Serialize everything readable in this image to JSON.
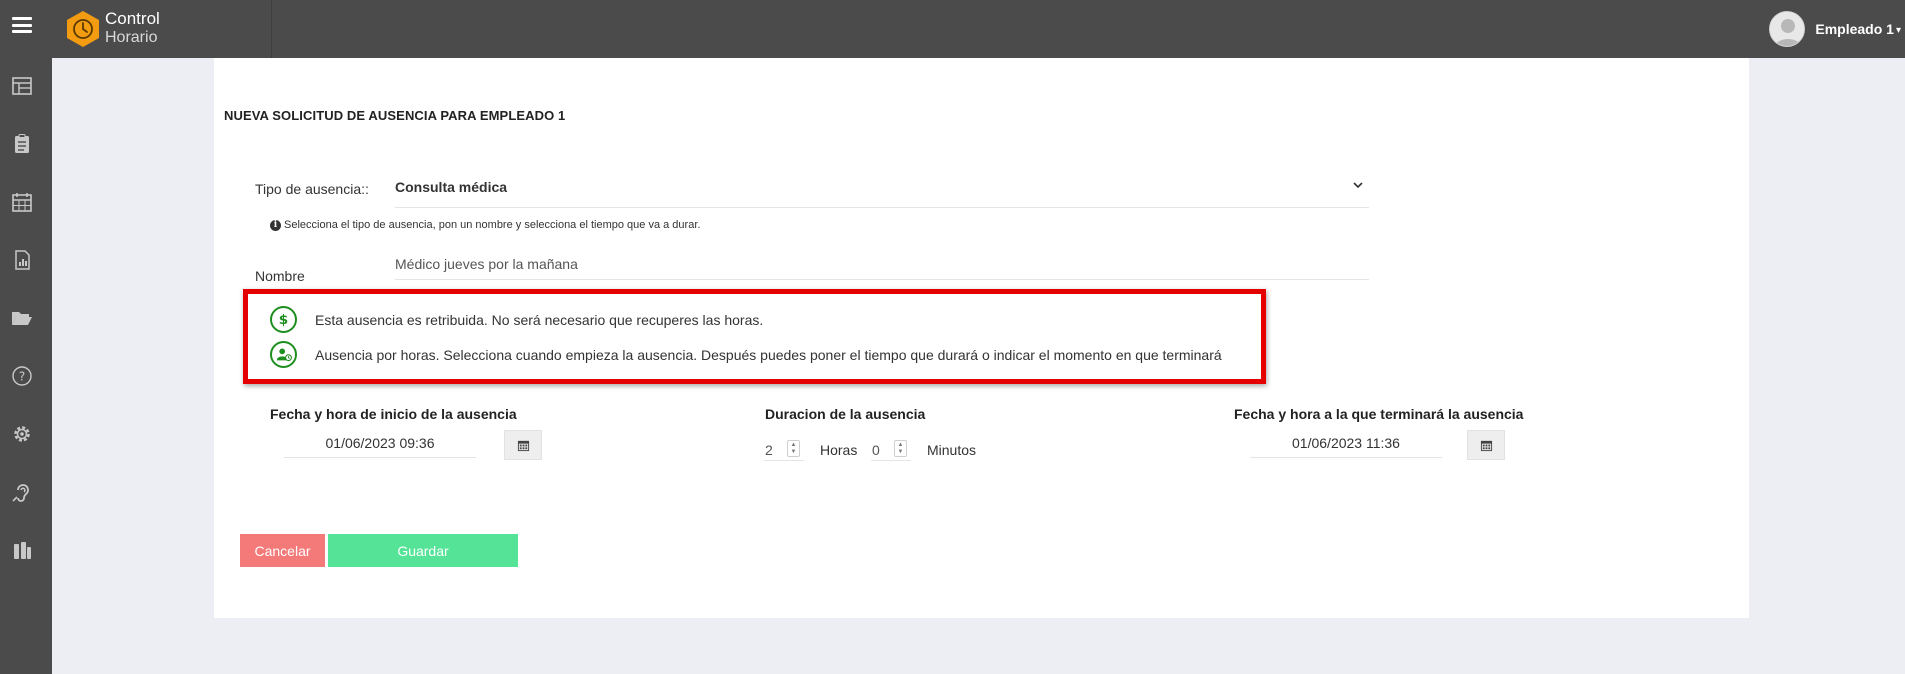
{
  "header": {
    "brand_line1": "Control",
    "brand_line2": "Horario",
    "user_name": "Empleado 1",
    "background": "#4b4b4b",
    "logo_color": "#f39c12"
  },
  "sidebar": {
    "items": [
      {
        "icon": "dashboard-icon"
      },
      {
        "icon": "clipboard-icon"
      },
      {
        "icon": "calendar-icon"
      },
      {
        "icon": "report-icon"
      },
      {
        "icon": "folder-open-icon"
      },
      {
        "icon": "help-icon"
      },
      {
        "icon": "gear-icon"
      },
      {
        "icon": "hearing-icon"
      },
      {
        "icon": "tools-icon"
      }
    ]
  },
  "form": {
    "title": "NUEVA SOLICITUD DE AUSENCIA PARA EMPLEADO 1",
    "absence_type_label": "Tipo de ausencia::",
    "absence_type_value": "Consulta médica",
    "hint": "Selecciona el tipo de ausencia, pon un nombre y selecciona el tiempo que va a durar.",
    "name_label": "Nombre",
    "name_value": "Médico jueves por la mañana",
    "info_paid": "Esta ausencia es retribuida. No será necesario que recuperes las horas.",
    "info_hours": "Ausencia por horas. Selecciona cuando empieza la ausencia. Después puedes poner el tiempo que durará o indicar el momento en que terminará",
    "start_label": "Fecha y hora de inicio de la ausencia",
    "start_value": "01/06/2023 09:36",
    "duration_label": "Duracion de la ausencia",
    "hours_value": "2",
    "hours_unit": "Horas",
    "minutes_value": "0",
    "minutes_unit": "Minutos",
    "end_label": "Fecha y hora a la que terminará la ausencia",
    "end_value": "01/06/2023 11:36",
    "cancel_label": "Cancelar",
    "save_label": "Guardar",
    "highlight_color": "#e50000",
    "icon_color": "#1e8e1e"
  }
}
